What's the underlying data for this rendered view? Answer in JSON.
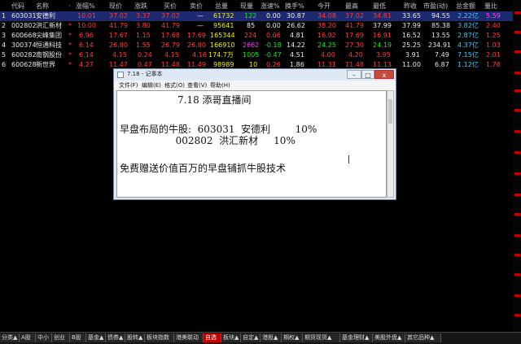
{
  "columns": [
    "代码",
    "名称",
    "·",
    "涨幅%",
    "现价",
    "涨跌",
    "买价",
    "卖价",
    "总量",
    "现量",
    "涨速%",
    "换手%",
    "今开",
    "最高",
    "最低",
    "昨收",
    "市盈(动)",
    "总金额",
    "量比"
  ],
  "rows": [
    {
      "idx": "1",
      "code": "603031",
      "name": "安德利",
      "flag": "",
      "pct": "10.01",
      "price": "37.02",
      "chg": "3.37",
      "bid": "37.02",
      "ask": "—",
      "vol": "61732",
      "cur": "122",
      "spd": "0.00",
      "turn": "30.87",
      "open": "34.08",
      "high": "37.02",
      "low": "34.81",
      "prev": "33.65",
      "pe": "94.55",
      "amt": "2.22亿",
      "ratio": "5.59"
    },
    {
      "idx": "2",
      "code": "002802",
      "name": "洪汇新材",
      "flag": "*",
      "pct": "10.00",
      "price": "41.79",
      "chg": "3.80",
      "bid": "41.79",
      "ask": "—",
      "vol": "95641",
      "cur": "85",
      "spd": "0.00",
      "turn": "26.62",
      "open": "38.20",
      "high": "41.79",
      "low": "37.99",
      "prev": "37.99",
      "pe": "85.38",
      "amt": "3.82亿",
      "ratio": "2.40"
    },
    {
      "idx": "3",
      "code": "600668",
      "name": "尖峰集团",
      "flag": "*",
      "pct": "6.96",
      "price": "17.67",
      "chg": "1.15",
      "bid": "17.68",
      "ask": "17.69",
      "vol": "165344",
      "cur": "224",
      "spd": "0.06",
      "turn": "4.81",
      "open": "16.92",
      "high": "17.69",
      "low": "16.91",
      "prev": "16.52",
      "pe": "13.55",
      "amt": "2.87亿",
      "ratio": "1.25"
    },
    {
      "idx": "4",
      "code": "300374",
      "name": "恒通科技",
      "flag": "*",
      "pct": "6.14",
      "price": "26.80",
      "chg": "1.55",
      "bid": "26.79",
      "ask": "26.80",
      "vol": "166910",
      "cur": "2662",
      "spd": "-0.18",
      "turn": "14.22",
      "open": "24.25",
      "high": "27.30",
      "low": "24.19",
      "prev": "25.25",
      "pe": "234.91",
      "amt": "4.37亿",
      "ratio": "1.03"
    },
    {
      "idx": "5",
      "code": "600282",
      "name": "南钢股份",
      "flag": "*",
      "pct": "6.14",
      "price": "4.15",
      "chg": "0.24",
      "bid": "4.15",
      "ask": "4.16",
      "vol": "174.7万",
      "cur": "1005",
      "spd": "-0.47",
      "turn": "4.51",
      "open": "4.00",
      "high": "4.20",
      "low": "3.95",
      "prev": "3.91",
      "pe": "7.49",
      "amt": "7.15亿",
      "ratio": "2.01"
    },
    {
      "idx": "6",
      "code": "600628",
      "name": "新世界",
      "flag": "*",
      "pct": "4.27",
      "price": "11.47",
      "chg": "0.47",
      "bid": "11.48",
      "ask": "11.49",
      "vol": "98989",
      "cur": "10",
      "spd": "0.26",
      "turn": "1.86",
      "open": "11.31",
      "high": "11.48",
      "low": "11.13",
      "prev": "11.00",
      "pe": "6.87",
      "amt": "1.12亿",
      "ratio": "1.76"
    }
  ],
  "notepad": {
    "title": "7.18 - 记事本",
    "menu": [
      "文件(F)",
      "编辑(E)",
      "格式(O)",
      "查看(V)",
      "帮助(H)"
    ],
    "lines": [
      "7.18 添哥直播间",
      "早盘布局的牛股:  603031  安德利        10%",
      "                  002802  洪汇新材     10%",
      "免费赠送价值百万的早盘铺抓牛股技术"
    ],
    "btn_min": "–",
    "btn_max": "□",
    "btn_close": "x"
  },
  "tabs": [
    "分类▲",
    "A股",
    "中小",
    "创业",
    "B股",
    "基金▲",
    "债券▲",
    "股转▲",
    "板块指数",
    "港美联动",
    "自选",
    "板块▲",
    "自定▲",
    "港股▲",
    "期权▲",
    "期货现货▲",
    "基金理财▲",
    "美股外盘▲",
    "其它品种▲"
  ],
  "active_tab": "自选"
}
